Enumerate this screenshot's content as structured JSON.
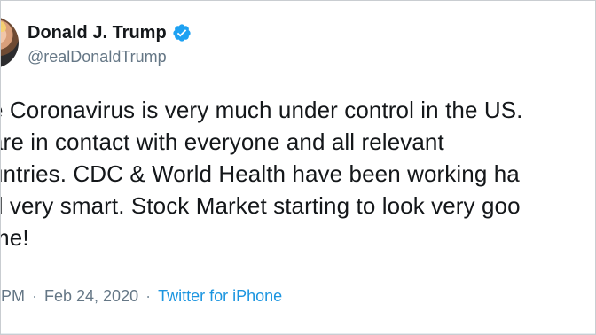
{
  "tweet": {
    "display_name": "Donald J. Trump",
    "handle": "@realDonaldTrump",
    "text": "e Coronavirus is very much under control in the US.\n are in contact with everyone and all relevant\nuntries. CDC & World Health have been working ha\nd very smart. Stock Market starting to look very goo\nme!",
    "time": "PM",
    "separator": "·",
    "date": "Feb 24, 2020",
    "source": "Twitter for iPhone"
  },
  "icons": {
    "verified": "verified-badge-icon",
    "avatar": "profile-photo"
  },
  "colors": {
    "name": "#14171a",
    "muted": "#657786",
    "link": "#1b95e0",
    "verified": "#1da1f2"
  }
}
